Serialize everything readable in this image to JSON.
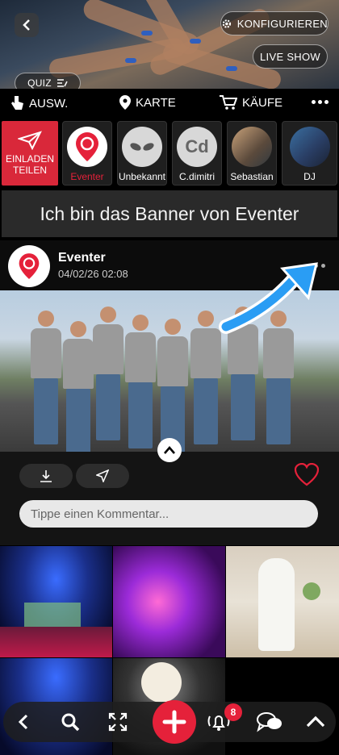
{
  "header": {
    "config_label": "KONFIGURIEREN",
    "live_label": "LIVE SHOW",
    "quiz_label": "QUIZ"
  },
  "menu": {
    "select_label": "AUSW.",
    "map_label": "KARTE",
    "purchases_label": "KÄUFE"
  },
  "stories": {
    "invite_label_1": "EINLADEN",
    "invite_label_2": "TEILEN",
    "items": [
      {
        "name": "Eventer"
      },
      {
        "name": "Unbekannt"
      },
      {
        "name": "C.dimitri",
        "initials": "Cd"
      },
      {
        "name": "Sebastian"
      },
      {
        "name": "DJ"
      }
    ]
  },
  "banner": {
    "text": "Ich bin das Banner von Eventer"
  },
  "post": {
    "author": "Eventer",
    "date": "04/02/26 02:08",
    "comment_placeholder": "Tippe einen Kommentar..."
  },
  "bottom_bar": {
    "notification_count": "8"
  },
  "colors": {
    "accent": "#e5213a",
    "arrow": "#2a9df4"
  }
}
